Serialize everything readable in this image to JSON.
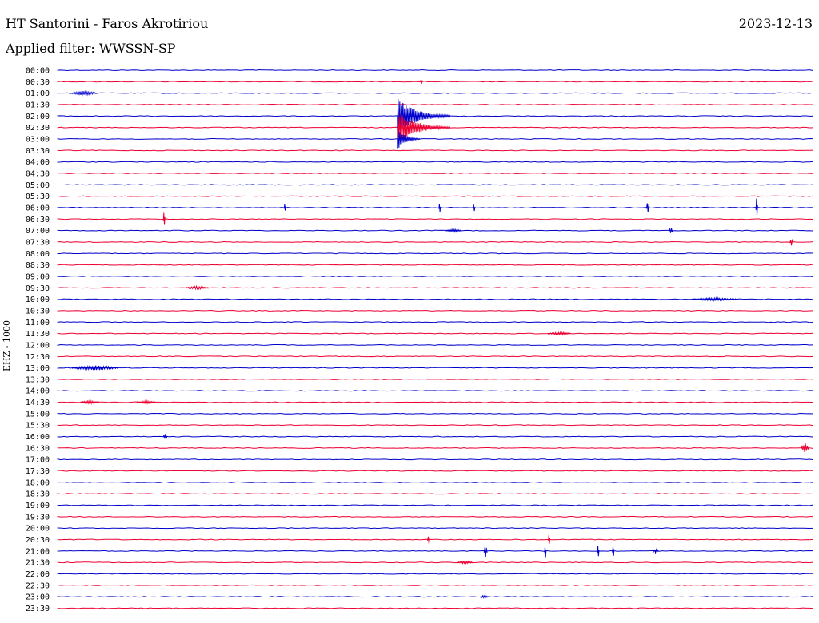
{
  "header": {
    "station": "HT Santorini - Faros Akrotiriou",
    "date": "2023-12-13",
    "filter": "Applied filter: WWSSN-SP",
    "channel_label": "EHZ - 1000"
  },
  "colors": {
    "blue": "#0000cc",
    "red": "#ee0033"
  },
  "rows": [
    "00:00",
    "00:30",
    "01:00",
    "01:30",
    "02:00",
    "02:30",
    "03:00",
    "03:30",
    "04:00",
    "04:30",
    "05:00",
    "05:30",
    "06:00",
    "06:30",
    "07:00",
    "07:30",
    "08:00",
    "08:30",
    "09:00",
    "09:30",
    "10:00",
    "10:30",
    "11:00",
    "11:30",
    "12:00",
    "12:30",
    "13:00",
    "13:30",
    "14:00",
    "14:30",
    "15:00",
    "15:30",
    "16:00",
    "16:30",
    "17:00",
    "17:30",
    "18:00",
    "18:30",
    "19:00",
    "19:30",
    "20:00",
    "20:30",
    "21:00",
    "21:30",
    "22:00",
    "22:30",
    "23:00",
    "23:30"
  ],
  "events": [
    {
      "row": 1,
      "t": 0.48,
      "amp": 3,
      "len": 0.004
    },
    {
      "row": 2,
      "t": 0.02,
      "amp": 3,
      "len": 0.03
    },
    {
      "row": 4,
      "t": 0.45,
      "amp": 24,
      "len": 0.07,
      "decay": true
    },
    {
      "row": 5,
      "t": 0.45,
      "amp": 22,
      "len": 0.07,
      "decay": true
    },
    {
      "row": 6,
      "t": 0.45,
      "amp": 14,
      "len": 0.03,
      "decay": true
    },
    {
      "row": 12,
      "t": 0.3,
      "amp": 8,
      "len": 0.002
    },
    {
      "row": 12,
      "t": 0.505,
      "amp": 8,
      "len": 0.002
    },
    {
      "row": 12,
      "t": 0.55,
      "amp": 6,
      "len": 0.003
    },
    {
      "row": 12,
      "t": 0.78,
      "amp": 9,
      "len": 0.004
    },
    {
      "row": 12,
      "t": 0.925,
      "amp": 16,
      "len": 0.002
    },
    {
      "row": 13,
      "t": 0.14,
      "amp": 12,
      "len": 0.002
    },
    {
      "row": 14,
      "t": 0.515,
      "amp": 2,
      "len": 0.02
    },
    {
      "row": 14,
      "t": 0.81,
      "amp": 4,
      "len": 0.005
    },
    {
      "row": 15,
      "t": 0.97,
      "amp": 6,
      "len": 0.004
    },
    {
      "row": 19,
      "t": 0.17,
      "amp": 2,
      "len": 0.03
    },
    {
      "row": 20,
      "t": 0.84,
      "amp": 2,
      "len": 0.06
    },
    {
      "row": 23,
      "t": 0.65,
      "amp": 2,
      "len": 0.03
    },
    {
      "row": 26,
      "t": 0.02,
      "amp": 3,
      "len": 0.06
    },
    {
      "row": 29,
      "t": 0.03,
      "amp": 2,
      "len": 0.025
    },
    {
      "row": 29,
      "t": 0.105,
      "amp": 2,
      "len": 0.025
    },
    {
      "row": 32,
      "t": 0.14,
      "amp": 5,
      "len": 0.005
    },
    {
      "row": 33,
      "t": 0.985,
      "amp": 7,
      "len": 0.01
    },
    {
      "row": 41,
      "t": 0.49,
      "amp": 8,
      "len": 0.003
    },
    {
      "row": 41,
      "t": 0.65,
      "amp": 9,
      "len": 0.002
    },
    {
      "row": 42,
      "t": 0.565,
      "amp": 10,
      "len": 0.004
    },
    {
      "row": 42,
      "t": 0.645,
      "amp": 12,
      "len": 0.002
    },
    {
      "row": 42,
      "t": 0.715,
      "amp": 12,
      "len": 0.002
    },
    {
      "row": 42,
      "t": 0.735,
      "amp": 12,
      "len": 0.002
    },
    {
      "row": 42,
      "t": 0.79,
      "amp": 3,
      "len": 0.006
    },
    {
      "row": 43,
      "t": 0.53,
      "amp": 2,
      "len": 0.02
    },
    {
      "row": 46,
      "t": 0.56,
      "amp": 2,
      "len": 0.01
    }
  ]
}
